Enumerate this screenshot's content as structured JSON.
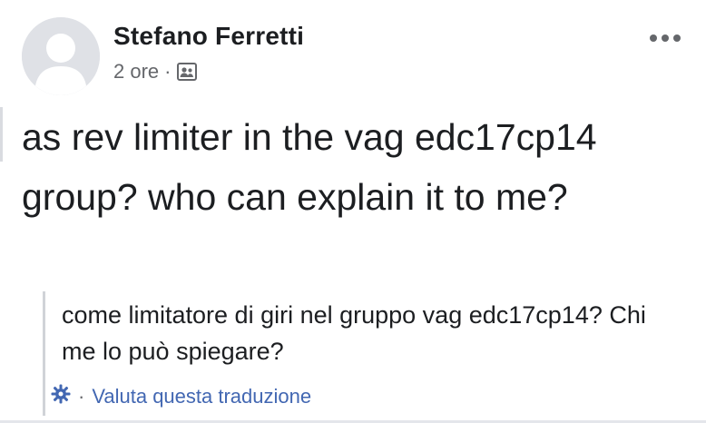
{
  "post": {
    "author": "Stefano Ferretti",
    "timestamp": "2 ore",
    "separator": "·",
    "audience_icon": "friends-audience-icon",
    "body": "as rev limiter in the vag edc17cp14 group? who can explain it to me?"
  },
  "translation": {
    "text": "come limitatore di giri nel gruppo vag edc17cp14? Chi me lo può spiegare?",
    "separator": "·",
    "rate_label": "Valuta questa traduzione"
  },
  "colors": {
    "text": "#1c1e21",
    "secondary": "#65676b",
    "link": "#4267b2",
    "avatar_bg": "#e4e6eb"
  }
}
